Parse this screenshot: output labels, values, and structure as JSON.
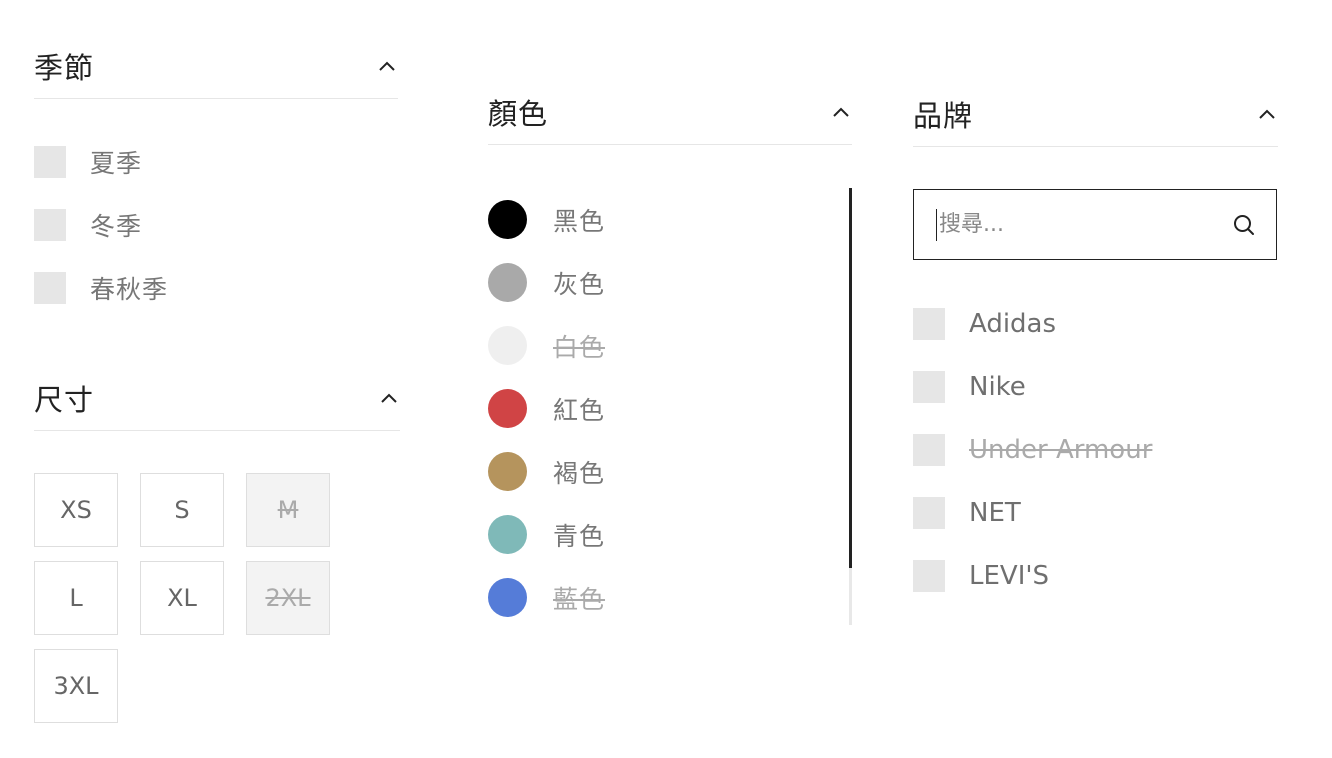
{
  "season": {
    "title": "季節",
    "items": [
      {
        "label": "夏季"
      },
      {
        "label": "冬季"
      },
      {
        "label": "春秋季"
      }
    ]
  },
  "size": {
    "title": "尺寸",
    "options": [
      {
        "label": "XS",
        "disabled": false
      },
      {
        "label": "S",
        "disabled": false
      },
      {
        "label": "M",
        "disabled": true
      },
      {
        "label": "L",
        "disabled": false
      },
      {
        "label": "XL",
        "disabled": false
      },
      {
        "label": "2XL",
        "disabled": true
      },
      {
        "label": "3XL",
        "disabled": false
      }
    ]
  },
  "color": {
    "title": "顏色",
    "items": [
      {
        "label": "黑色",
        "swatch": "#000000",
        "disabled": false
      },
      {
        "label": "灰色",
        "swatch": "#a9a9a9",
        "disabled": false
      },
      {
        "label": "白色",
        "swatch": "#efefef",
        "disabled": true
      },
      {
        "label": "紅色",
        "swatch": "#d04445",
        "disabled": false
      },
      {
        "label": "褐色",
        "swatch": "#b5945d",
        "disabled": false
      },
      {
        "label": "青色",
        "swatch": "#7fb9b8",
        "disabled": false
      },
      {
        "label": "藍色",
        "swatch": "#557cd8",
        "disabled": true
      }
    ]
  },
  "brand": {
    "title": "品牌",
    "search_placeholder": "搜尋...",
    "items": [
      {
        "label": "Adidas",
        "disabled": false
      },
      {
        "label": "Nike",
        "disabled": false
      },
      {
        "label": "Under Armour",
        "disabled": true
      },
      {
        "label": "NET",
        "disabled": false
      },
      {
        "label": "LEVI'S",
        "disabled": false
      }
    ]
  }
}
